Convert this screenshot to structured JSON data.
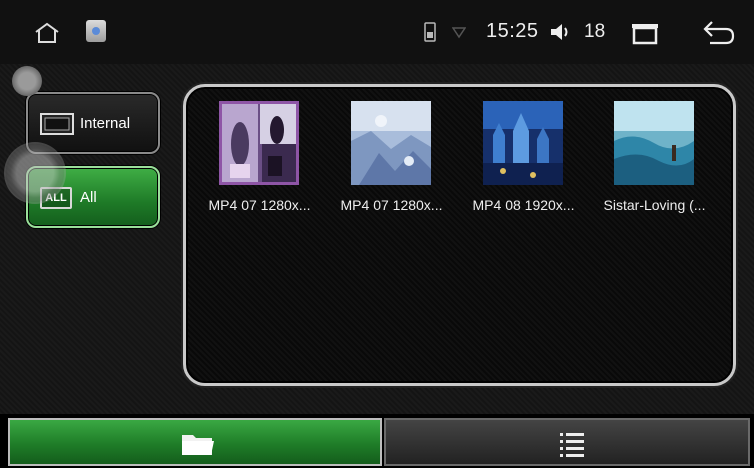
{
  "status_bar": {
    "time": "15:25",
    "volume_level": "18",
    "icons": [
      "home-icon",
      "app-icon",
      "sim-icon",
      "signal-icon",
      "volume-icon",
      "recents-icon",
      "back-icon"
    ]
  },
  "sources": [
    {
      "label": "Internal",
      "icon": "storage-icon",
      "selected": false
    },
    {
      "label": "All",
      "badge": "ALL",
      "selected": true
    }
  ],
  "files": [
    {
      "name": "MP4 07 1280x...",
      "selected": true
    },
    {
      "name": "MP4 07 1280x...",
      "selected": false
    },
    {
      "name": "MP4 08 1920x...",
      "selected": false
    },
    {
      "name": "Sistar-Loving (...",
      "selected": false
    }
  ],
  "bottom_tabs": [
    {
      "icon": "folder-icon",
      "active": true
    },
    {
      "icon": "list-icon",
      "active": false
    }
  ],
  "colors": {
    "accent_green": "#2a9433",
    "selection_purple": "#8e55a6",
    "background": "#0c0c0c"
  }
}
